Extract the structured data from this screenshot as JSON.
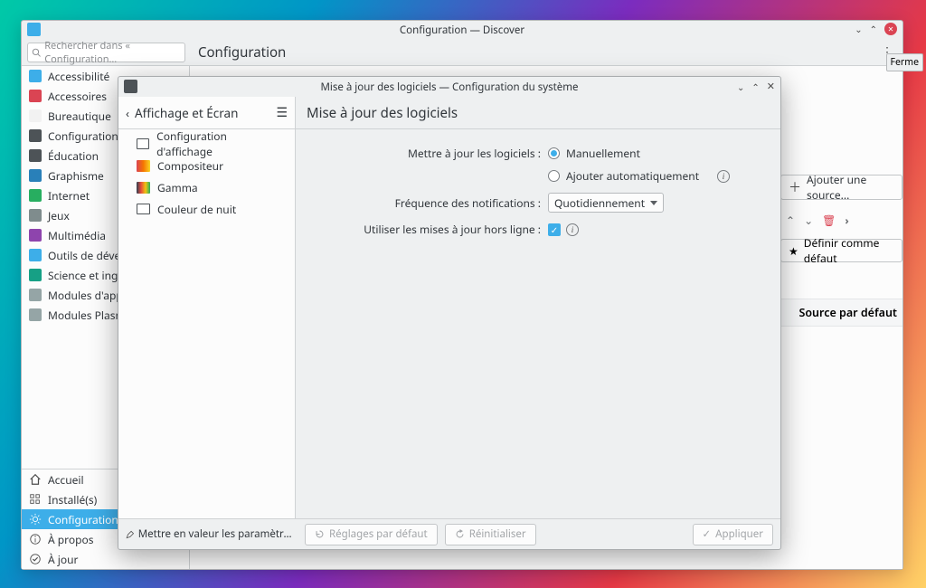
{
  "back": {
    "title": "Configuration — Discover",
    "search_placeholder": "Rechercher dans « Configuration…",
    "header": "Configuration",
    "categories": [
      {
        "label": "Accessibilité",
        "color": "#3daee9"
      },
      {
        "label": "Accessoires",
        "color": "#da4453"
      },
      {
        "label": "Bureautique",
        "color": "#f2f2f2"
      },
      {
        "label": "Configuration du s",
        "color": "#4d5357"
      },
      {
        "label": "Éducation",
        "color": "#4d5357"
      },
      {
        "label": "Graphisme",
        "color": "#2980b9"
      },
      {
        "label": "Internet",
        "color": "#27ae60"
      },
      {
        "label": "Jeux",
        "color": "#7f8c8d"
      },
      {
        "label": "Multimédia",
        "color": "#8e44ad"
      },
      {
        "label": "Outils de développ",
        "color": "#3daee9"
      },
      {
        "label": "Science et ingénier",
        "color": "#16a085"
      },
      {
        "label": "Modules d'applicati",
        "color": "#95a5a6"
      },
      {
        "label": "Modules Plasma",
        "color": "#95a5a6"
      }
    ],
    "bottom_nav": [
      {
        "label": "Accueil"
      },
      {
        "label": "Installé(s)"
      },
      {
        "label": "Configuration",
        "selected": true
      },
      {
        "label": "À propos"
      },
      {
        "label": "À jour"
      }
    ],
    "right": {
      "add_source": "Ajouter une source...",
      "set_default": "Définir comme défaut",
      "source_default_header": "Source par défaut"
    },
    "tooltip_close": "Ferme"
  },
  "front": {
    "title": "Mise à jour des logiciels — Configuration du système",
    "sidebar_header": "Affichage et Écran",
    "sidebar_items": [
      {
        "label": "Configuration d'affichage"
      },
      {
        "label": "Compositeur"
      },
      {
        "label": "Gamma"
      },
      {
        "label": "Couleur de nuit"
      }
    ],
    "main_header": "Mise à jour des logiciels",
    "form": {
      "update_label": "Mettre à jour les logiciels :",
      "update_opt_manual": "Manuellement",
      "update_opt_auto": "Ajouter automatiquement",
      "freq_label": "Fréquence des notifications :",
      "freq_value": "Quotidiennement",
      "offline_label": "Utiliser les mises à jour hors ligne :"
    },
    "footer": {
      "highlight": "Mettre en valeur les paramètres modifié",
      "defaults": "Réglages par défaut",
      "reset": "Réinitialiser",
      "apply": "Appliquer"
    }
  }
}
